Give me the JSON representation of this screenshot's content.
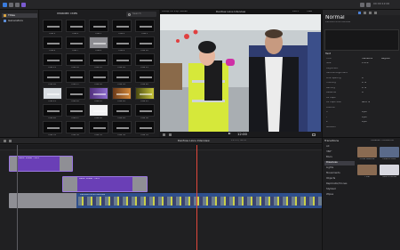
{
  "toolbar": {
    "timecode": "00:00:12:00",
    "icons": [
      "import-icon",
      "keywords-icon",
      "background-tasks-icon",
      "share-icon",
      "layout-icon",
      "view-icon"
    ]
  },
  "sidebar": {
    "items": [
      {
        "label": "Titles",
        "selected": true
      },
      {
        "label": "Generators",
        "selected": false
      }
    ]
  },
  "browser": {
    "header": "Installed Titles",
    "search_placeholder": "Search",
    "thumbnails": [
      {
        "caption": "Title 1",
        "style": "dark"
      },
      {
        "caption": "Title 2",
        "style": "dark"
      },
      {
        "caption": "Title 3",
        "style": "dark"
      },
      {
        "caption": "Title 4",
        "style": "dark"
      },
      {
        "caption": "Title 5",
        "style": "dark"
      },
      {
        "caption": "Title 6",
        "style": "dark"
      },
      {
        "caption": "Title 7",
        "style": "dark"
      },
      {
        "caption": "Title 8",
        "style": "grey"
      },
      {
        "caption": "Title 9",
        "style": "dark"
      },
      {
        "caption": "Title 10",
        "style": "dark"
      },
      {
        "caption": "Title 11",
        "style": "dark"
      },
      {
        "caption": "Title 12",
        "style": "dark"
      },
      {
        "caption": "Title 13",
        "style": "dark"
      },
      {
        "caption": "Title 14",
        "style": "dark"
      },
      {
        "caption": "Title 15",
        "style": "dark"
      },
      {
        "caption": "Title 16",
        "style": "dark"
      },
      {
        "caption": "Title 17",
        "style": "dark"
      },
      {
        "caption": "Title 18",
        "style": "dark"
      },
      {
        "caption": "Title 19",
        "style": "dark"
      },
      {
        "caption": "Title 20",
        "style": "dark"
      },
      {
        "caption": "Title 21",
        "style": "light"
      },
      {
        "caption": "Title 22",
        "style": "dark"
      },
      {
        "caption": "Title 23",
        "style": "purple"
      },
      {
        "caption": "Title 24",
        "style": "orange"
      },
      {
        "caption": "Title 25",
        "style": "yellow"
      },
      {
        "caption": "Title 26",
        "style": "dark"
      },
      {
        "caption": "Title 27",
        "style": "dark"
      },
      {
        "caption": "Title 28",
        "style": "white"
      },
      {
        "caption": "Title 29",
        "style": "dark"
      },
      {
        "caption": "Title 30",
        "style": "dark"
      },
      {
        "caption": "Title 31",
        "style": "dark"
      },
      {
        "caption": "Title 32",
        "style": "dark"
      },
      {
        "caption": "Title 33",
        "style": "dark"
      },
      {
        "caption": "Title 34",
        "style": "dark"
      },
      {
        "caption": "Title 35",
        "style": "dark"
      }
    ]
  },
  "viewer": {
    "format": "1080p HD 25p, Stereo",
    "project": "Danfoss Lions Interview",
    "zoom": "100%",
    "view_label": "View",
    "timecode": "12:00"
  },
  "inspector": {
    "title": "Normal",
    "subtitle": "Danfoss Lions Interview",
    "section": "Text",
    "rows": [
      {
        "label": "Font",
        "value": "Helvetica",
        "value2": "Regular"
      },
      {
        "label": "Size",
        "value": "170.0"
      },
      {
        "label": "Alignment",
        "value": ""
      },
      {
        "label": "Vertical Alignment",
        "value": ""
      },
      {
        "label": "Line Spacing",
        "value": "0"
      },
      {
        "label": "Tracking",
        "value": "0 %"
      },
      {
        "label": "Kerning",
        "value": "0 %"
      },
      {
        "label": "Baseline",
        "value": "0"
      },
      {
        "label": "All Caps",
        "value": ""
      },
      {
        "label": "All Caps Size",
        "value": "80.0 %"
      },
      {
        "label": "Position",
        "value": ""
      },
      {
        "label": "X",
        "value": "0 px"
      },
      {
        "label": "Y",
        "value": "0 px"
      },
      {
        "label": "Z",
        "value": "0 px"
      },
      {
        "label": "Rotation",
        "value": ""
      }
    ]
  },
  "timeline": {
    "title": "Danfoss Lions Interview",
    "duration": "11:15 / 40:00",
    "clips": [
      {
        "label": "Basic Lower Third",
        "color": "#6a3fb6"
      },
      {
        "label": "Basic Lower Third",
        "color": "#6a3fb6"
      },
      {
        "label": "Danfoss Lions Interview",
        "color": "#2f4f8c"
      }
    ]
  },
  "transitions": {
    "header": "Transitions",
    "subheader": "Installed Transitions",
    "categories": [
      {
        "label": "All",
        "selected": false
      },
      {
        "label": "360°",
        "selected": false
      },
      {
        "label": "Blurs",
        "selected": false
      },
      {
        "label": "Dissolves",
        "selected": true
      },
      {
        "label": "Lights",
        "selected": false
      },
      {
        "label": "Movements",
        "selected": false
      },
      {
        "label": "Objects",
        "selected": false
      },
      {
        "label": "Replicator/Clones",
        "selected": false
      },
      {
        "label": "Stylized",
        "selected": false
      },
      {
        "label": "Wipes",
        "selected": false
      }
    ],
    "items": [
      {
        "caption": "Cross Dissolve",
        "bg": "#8a6b52"
      },
      {
        "caption": "Fade to Color",
        "bg": "#5a6a8a"
      },
      {
        "caption": "Flow",
        "bg": "#8a6b52"
      },
      {
        "caption": "Fade To White",
        "bg": "#d8d8e0"
      }
    ]
  }
}
